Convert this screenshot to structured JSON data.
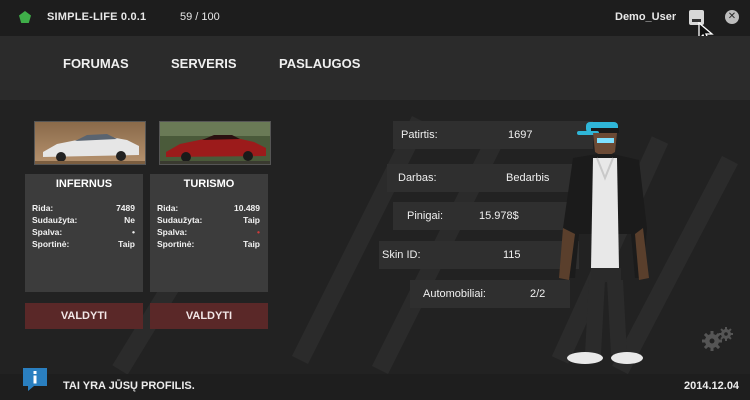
{
  "app": {
    "title": "SIMPLE-LIFE 0.0.1",
    "online": "59 / 100",
    "user": "Demo_User"
  },
  "nav": {
    "items": [
      "FORUMAS",
      "SERVERIS",
      "PASLAUGOS"
    ]
  },
  "cars": [
    {
      "name": "INFERNUS",
      "color": "#e6e6e6",
      "rows": [
        {
          "label": "Rida:",
          "value": "7489"
        },
        {
          "label": "Sudaužyta:",
          "value": "Ne"
        },
        {
          "label": "Spalva:",
          "value": "•"
        },
        {
          "label": "Sportinė:",
          "value": "Taip"
        }
      ],
      "button": "VALDYTI"
    },
    {
      "name": "TURISMO",
      "color": "#9c1b1b",
      "rows": [
        {
          "label": "Rida:",
          "value": "10.489"
        },
        {
          "label": "Sudaužyta:",
          "value": "Taip"
        },
        {
          "label": "Spalva:",
          "value": "•"
        },
        {
          "label": "Sportinė:",
          "value": "Taip"
        }
      ],
      "button": "VALDYTI"
    }
  ],
  "stats": {
    "patirtis": {
      "label": "Patirtis:",
      "value": "1697"
    },
    "darbas": {
      "label": "Darbas:",
      "value": "Bedarbis"
    },
    "pinigai": {
      "label": "Pinigai:",
      "value": "15.978$"
    },
    "skin": {
      "label": "Skin ID:",
      "value": "115"
    },
    "auto": {
      "label": "Automobiliai:",
      "value": "2/2"
    }
  },
  "footer": {
    "message": "TAI YRA JŪSŲ PROFILIS.",
    "date": "2014.12.04"
  },
  "colors": {
    "accent_green": "#3fae49",
    "manage_button": "#5a2828",
    "info_blue": "#2a7fc0",
    "skin_cap": "#2fb6d8"
  },
  "icons": [
    "app-icon",
    "minimize-icon",
    "close-icon",
    "cursor-icon",
    "settings-gears-icon",
    "info-icon"
  ]
}
